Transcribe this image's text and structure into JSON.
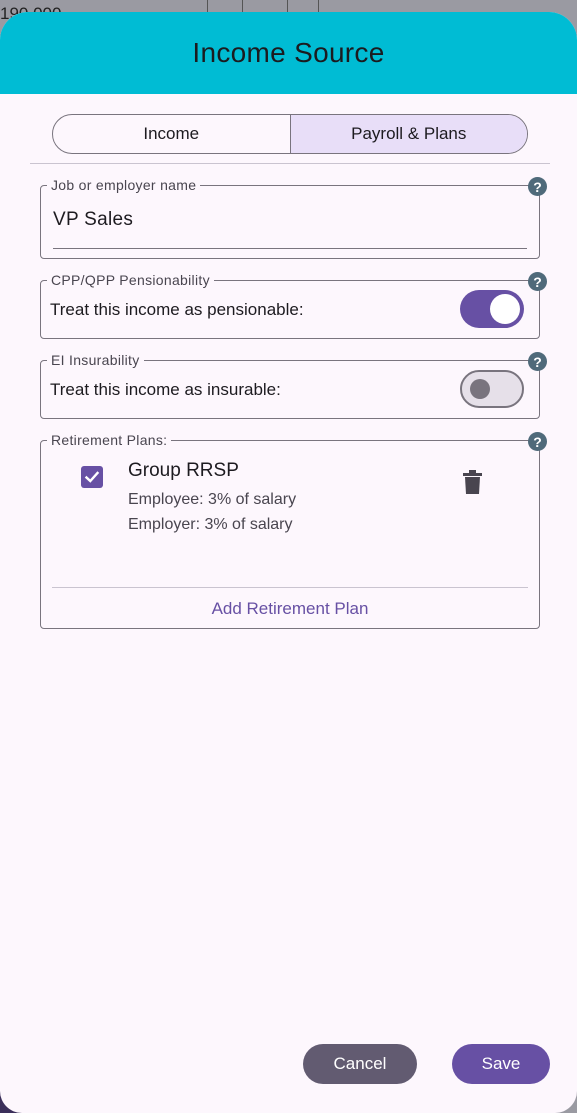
{
  "backdrop": {
    "partial_text": "190 000"
  },
  "dialog": {
    "title": "Income Source",
    "tabs": [
      {
        "label": "Income",
        "selected": false
      },
      {
        "label": "Payroll & Plans",
        "selected": true
      }
    ],
    "job": {
      "legend": "Job or employer name",
      "value": "VP Sales"
    },
    "cpp": {
      "legend": "CPP/QPP Pensionability",
      "label": "Treat this income as pensionable:",
      "on": true
    },
    "ei": {
      "legend": "EI Insurability",
      "label": "Treat this income as insurable:",
      "on": false
    },
    "retirement": {
      "legend": "Retirement Plans:",
      "plans": [
        {
          "name": "Group RRSP",
          "employee": "Employee: 3% of salary",
          "employer": "Employer: 3% of salary",
          "checked": true
        }
      ],
      "add_label": "Add Retirement Plan"
    },
    "help_glyph": "?",
    "buttons": {
      "cancel": "Cancel",
      "save": "Save"
    }
  },
  "colors": {
    "header": "#00bcd4",
    "accent": "#6750a4",
    "secondary": "#625b71",
    "surface": "#fdf7fd"
  }
}
